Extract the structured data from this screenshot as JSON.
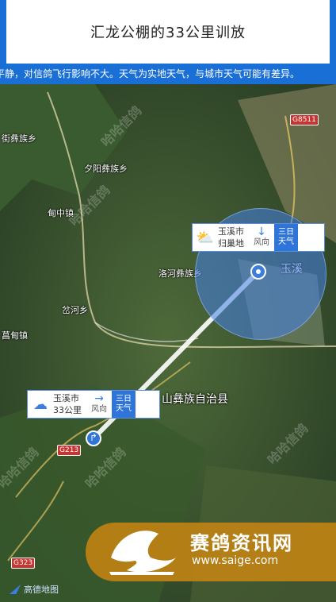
{
  "header": {
    "title": "汇龙公棚的33公里训放"
  },
  "notice": {
    "text": "平静，对信鸽飞行影响不大。天气为实地天气，与城市天气可能有差异。"
  },
  "places": {
    "p1": "街彝族乡",
    "p2": "夕阳彝族乡",
    "p3": "甸中镇",
    "p4": "洛河彝族乡",
    "p5": "岔河乡",
    "p6": "菖甸镇",
    "p7": "玉溪",
    "county": "山彝族自治县"
  },
  "roads": {
    "r1": "G8511",
    "r2": "G213",
    "r3": "G323"
  },
  "dest_card": {
    "city": "玉溪市",
    "sub": "归巢地",
    "wind_label": "风向",
    "wind_arrow": "↓",
    "three_day_1": "三日",
    "three_day_2": "天气"
  },
  "start_card": {
    "city": "玉溪市",
    "sub": "33公里",
    "wind_label": "风向",
    "wind_arrow": "→",
    "three_day_1": "三日",
    "three_day_2": "天气"
  },
  "watermark": {
    "name": "赛鸽资讯网",
    "url": "www.saige.com",
    "ghost": "哈哈信鸽"
  },
  "attribution": {
    "text": "高德地图"
  },
  "colors": {
    "accent": "#1a6fd6",
    "range": "#4682e6",
    "watermark_bg": "#be8214"
  },
  "icons": {
    "weather_dest": "sun-cloud-icon",
    "weather_start": "cloud-icon"
  }
}
